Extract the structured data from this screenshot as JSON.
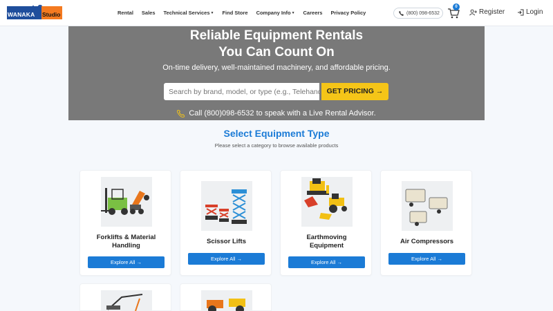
{
  "logo": {
    "left_text": "WANAKA",
    "right_text": "Studio"
  },
  "nav": {
    "items": [
      "Rental",
      "Sales",
      "Technical Services",
      "Find Store",
      "Company Info",
      "Careers",
      "Privacy Policy"
    ]
  },
  "header": {
    "phone": "(800) 098-6532",
    "cart_count": "0",
    "register": "Register",
    "login": "Login"
  },
  "hero": {
    "title_line1": "Reliable Equipment Rentals",
    "title_line2": "You Can Count On",
    "subtitle": "On-time delivery, well-maintained machinery, and affordable pricing.",
    "search_placeholder": "Search by brand, model, or type (e.g., Telehandler)",
    "cta": "GET PRICING →",
    "advisor": "Call (800)098-6532 to speak with a Live Rental Advisor."
  },
  "section": {
    "title": "Select Equipment Type",
    "subtitle": "Please select a category to browse available products"
  },
  "categories": [
    {
      "title_l1": "Forklifts & Material",
      "title_l2": "Handling",
      "button": "Explore All →"
    },
    {
      "title_l1": "Scissor Lifts",
      "title_l2": "",
      "button": "Explore All →"
    },
    {
      "title_l1": "Earthmoving",
      "title_l2": "Equipment",
      "button": "Explore All →"
    },
    {
      "title_l1": "Air Compressors",
      "title_l2": "",
      "button": "Explore All →"
    }
  ],
  "colors": {
    "brand_blue": "#1b7bd6",
    "accent_yellow": "#f5c518",
    "hero_bg": "#797979"
  }
}
